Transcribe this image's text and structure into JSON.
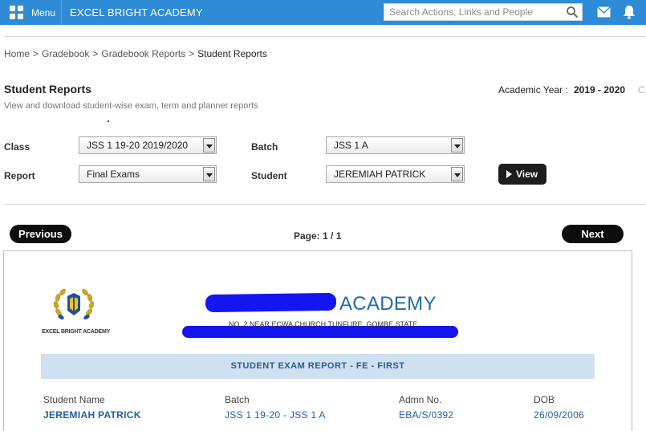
{
  "topbar": {
    "menu_label": "Menu",
    "org_name": "EXCEL BRIGHT ACADEMY",
    "search_placeholder": "Search Actions, Links and People",
    "accent": "#2e8bd6"
  },
  "breadcrumb": {
    "items": [
      "Home",
      "Gradebook",
      "Gradebook Reports"
    ],
    "separator": ">",
    "current": "Student Reports"
  },
  "page": {
    "title": "Student Reports",
    "subtitle": "View and download student-wise exam, term and planner reports",
    "academic_year_label": "Academic Year :",
    "academic_year_value": "2019 - 2020",
    "academic_year_change": "C"
  },
  "filters": {
    "class_label": "Class",
    "class_value": "JSS 1 19-20 2019/2020",
    "batch_label": "Batch",
    "batch_value": "JSS 1 A",
    "report_label": "Report",
    "report_value": "Final Exams",
    "student_label": "Student",
    "student_value": "JEREMIAH PATRICK",
    "view_label": "View"
  },
  "pager": {
    "previous": "Previous",
    "next": "Next",
    "page_indicator": "Page: 1 / 1"
  },
  "report": {
    "logo_caption": "EXCEL BRIGHT ACADEMY",
    "school_name_visible": "ACADEMY",
    "school_address": "NO. 2 NEAR ECWA CHURCH TUNFURE, GOMBE STATE",
    "banner": "STUDENT EXAM REPORT - FE - FIRST",
    "fields": [
      {
        "label": "Student Name",
        "value": "JEREMIAH PATRICK"
      },
      {
        "label": "Batch",
        "value": "JSS 1 19-20 - JSS 1 A"
      },
      {
        "label": "Admn No.",
        "value": "EBA/S/0392"
      },
      {
        "label": "DOB",
        "value": "26/09/2006"
      }
    ],
    "redaction_color": "#1515f0",
    "banner_bg": "#cfe0f1",
    "title_color": "#1f6aa8"
  }
}
